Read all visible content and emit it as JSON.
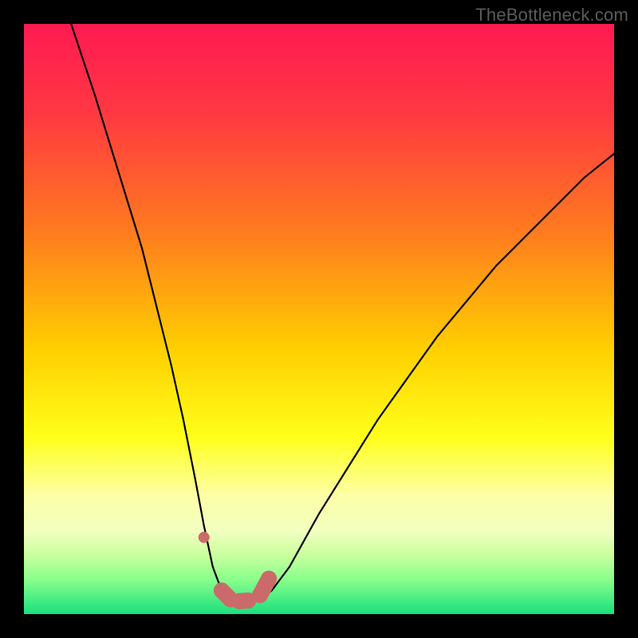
{
  "watermark": "TheBottleneck.com",
  "colors": {
    "black": "#000000",
    "curve": "#000000",
    "marker": "#cb6a6a",
    "gradient_stops": [
      {
        "offset": 0.0,
        "color": "#ff1a52"
      },
      {
        "offset": 0.15,
        "color": "#ff3842"
      },
      {
        "offset": 0.35,
        "color": "#ff7a1f"
      },
      {
        "offset": 0.55,
        "color": "#ffcf00"
      },
      {
        "offset": 0.7,
        "color": "#ffff1a"
      },
      {
        "offset": 0.8,
        "color": "#fdffa8"
      },
      {
        "offset": 0.86,
        "color": "#f1ffbf"
      },
      {
        "offset": 0.9,
        "color": "#c9ff9e"
      },
      {
        "offset": 0.94,
        "color": "#8cff8c"
      },
      {
        "offset": 1.0,
        "color": "#18e07e"
      }
    ]
  },
  "chart_data": {
    "type": "line",
    "title": "",
    "xlabel": "",
    "ylabel": "",
    "xlim": [
      0,
      100
    ],
    "ylim": [
      0,
      100
    ],
    "series": [
      {
        "name": "bottleneck-curve",
        "x": [
          8,
          12,
          16,
          20,
          23,
          25,
          27,
          29,
          30.5,
          32,
          33.5,
          35,
          36.5,
          38,
          40,
          42,
          45,
          50,
          55,
          60,
          65,
          70,
          75,
          80,
          85,
          90,
          95,
          100
        ],
        "y": [
          100,
          88,
          75,
          62,
          50,
          42,
          33,
          23,
          15,
          8,
          4,
          2.3,
          2.0,
          2.0,
          2.3,
          4,
          8,
          17,
          25,
          33,
          40,
          47,
          53,
          59,
          64,
          69,
          74,
          78
        ]
      }
    ],
    "markers": {
      "name": "optimal-range",
      "x": [
        30.5,
        33.5,
        35,
        36.5,
        38,
        40,
        41.5
      ],
      "y": [
        13,
        4,
        2.5,
        2.2,
        2.3,
        3.2,
        6
      ]
    }
  }
}
